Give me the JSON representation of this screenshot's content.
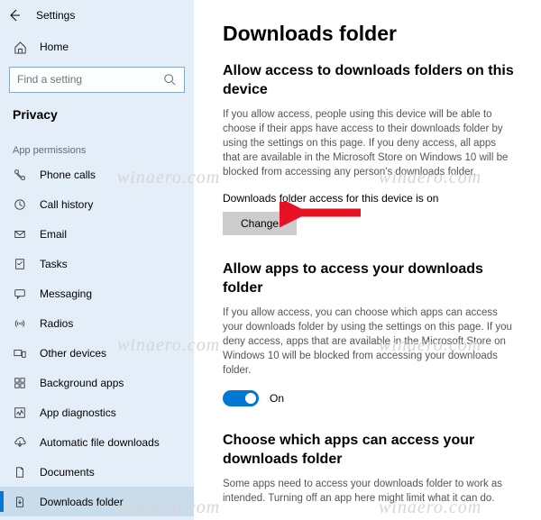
{
  "app_title": "Settings",
  "home_label": "Home",
  "search_placeholder": "Find a setting",
  "section_title": "Privacy",
  "group_label": "App permissions",
  "nav": [
    {
      "icon": "phone",
      "label": "Phone calls"
    },
    {
      "icon": "clock",
      "label": "Call history"
    },
    {
      "icon": "mail",
      "label": "Email"
    },
    {
      "icon": "tasks",
      "label": "Tasks"
    },
    {
      "icon": "msg",
      "label": "Messaging"
    },
    {
      "icon": "radio",
      "label": "Radios"
    },
    {
      "icon": "devices",
      "label": "Other devices"
    },
    {
      "icon": "bgapps",
      "label": "Background apps"
    },
    {
      "icon": "diag",
      "label": "App diagnostics"
    },
    {
      "icon": "auto",
      "label": "Automatic file downloads"
    },
    {
      "icon": "doc",
      "label": "Documents"
    },
    {
      "icon": "dlfolder",
      "label": "Downloads folder"
    }
  ],
  "page": {
    "title": "Downloads folder",
    "section1": {
      "heading": "Allow access to downloads folders on this device",
      "desc": "If you allow access, people using this device will be able to choose if their apps have access to their downloads folder by using the settings on this page. If you deny access, all apps that are available in the Microsoft Store on Windows 10 will be blocked from accessing any person's downloads folder.",
      "status_label": "Downloads folder access for this device is on",
      "change_label": "Change"
    },
    "section2": {
      "heading": "Allow apps to access your downloads folder",
      "desc": "If you allow access, you can choose which apps can access your downloads folder by using the settings on this page. If you deny access, apps that are available in the Microsoft Store on Windows 10 will be blocked from accessing your downloads folder.",
      "toggle_label": "On"
    },
    "section3": {
      "heading": "Choose which apps can access your downloads folder",
      "desc": "Some apps need to access your downloads folder to work as intended. Turning off an app here might limit what it can do."
    }
  },
  "watermark": "winaero.com"
}
